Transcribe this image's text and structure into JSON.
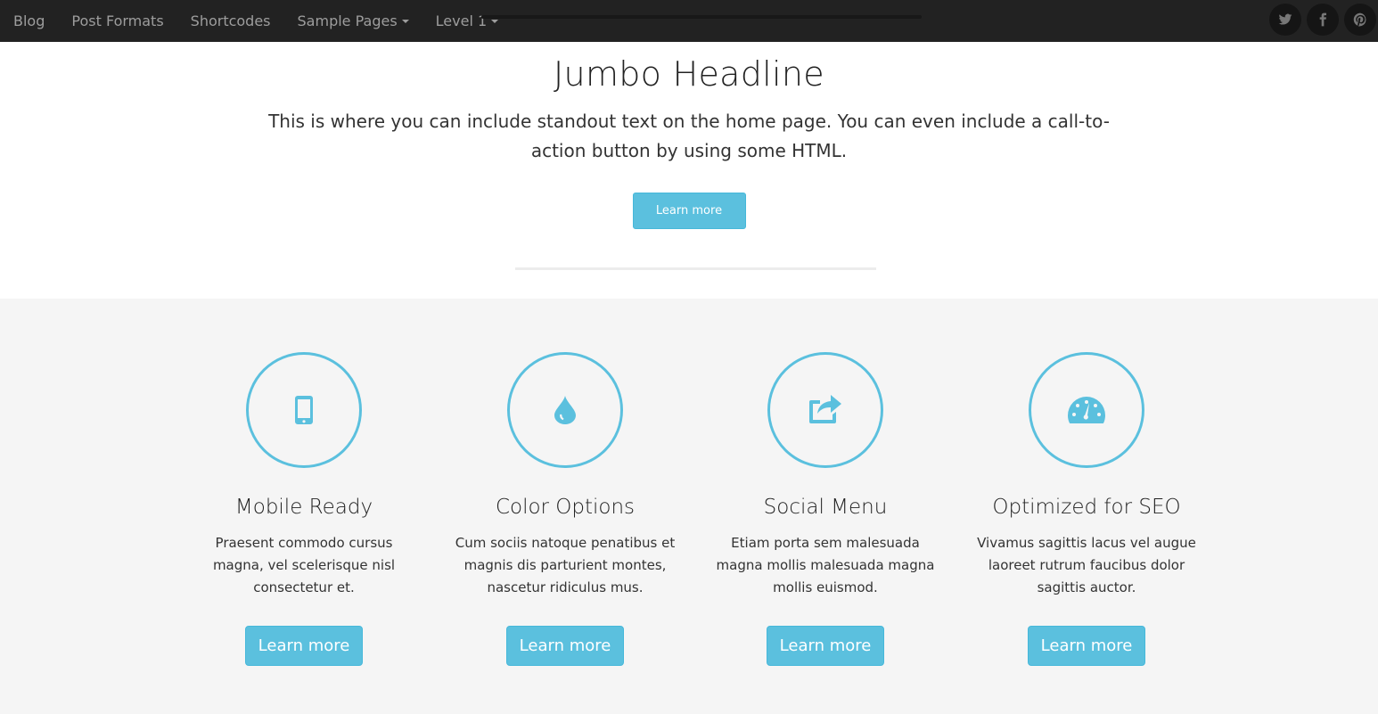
{
  "nav": {
    "items": [
      {
        "label": "Blog"
      },
      {
        "label": "Post Formats"
      },
      {
        "label": "Shortcodes"
      },
      {
        "label": "Sample Pages"
      },
      {
        "label": "Level 1"
      }
    ],
    "social": [
      "twitter-icon",
      "facebook-icon",
      "pinterest-icon"
    ]
  },
  "hero": {
    "title": "Jumbo Headline",
    "text": "This is where you can include standout text on the home page. You can even include a call-to-action button by using some HTML.",
    "button_label": "Learn more"
  },
  "features": [
    {
      "icon": "mobile-icon",
      "title": "Mobile Ready",
      "text": "Praesent commodo cursus magna, vel scelerisque nisl consectetur et.",
      "button_label": "Learn more"
    },
    {
      "icon": "droplet-icon",
      "title": "Color Options",
      "text": "Cum sociis natoque penatibus et magnis dis parturient montes, nascetur ridiculus mus.",
      "button_label": "Learn more"
    },
    {
      "icon": "share-icon",
      "title": "Social Menu",
      "text": "Etiam porta sem malesuada magna mollis malesuada magna mollis euismod.",
      "button_label": "Learn more"
    },
    {
      "icon": "dashboard-icon",
      "title": "Optimized for SEO",
      "text": "Vivamus sagittis lacus vel augue laoreet rutrum faucibus dolor sagittis auctor.",
      "button_label": "Learn more"
    }
  ],
  "colors": {
    "accent": "#5bc0de",
    "navbar": "#222222",
    "features_bg": "#f5f5f5"
  }
}
